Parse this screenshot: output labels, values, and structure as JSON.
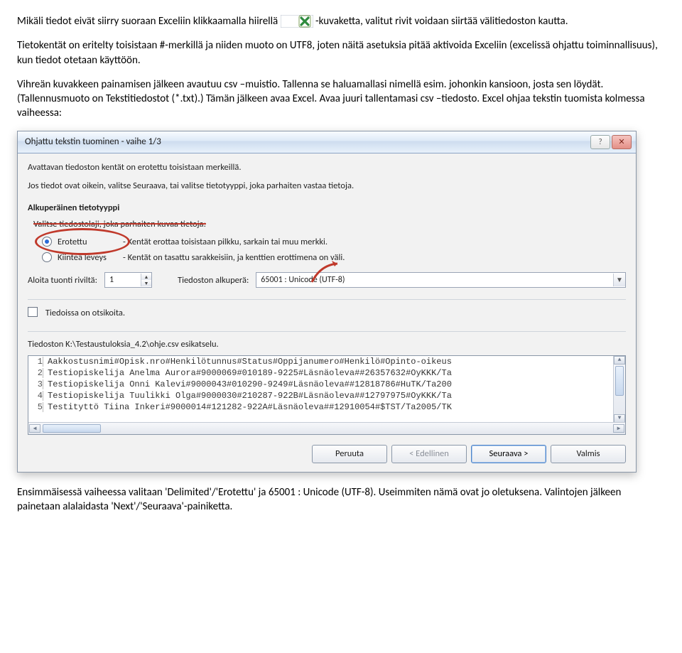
{
  "doc": {
    "p1a": "Mikäli tiedot eivät siirry suoraan Exceliin klikkaamalla hiirellä ",
    "p1b": "-kuvaketta, valitut rivit voidaan siirtää välitiedoston kautta.",
    "p2": "Tietokentät on eritelty toisistaan #-merkillä ja niiden muoto on UTF8, joten näitä asetuksia pitää aktivoida Exceliin (excelissä ohjattu toiminnallisuus), kun tiedot otetaan käyttöön.",
    "p3": "Vihreän kuvakkeen painamisen jälkeen avautuu csv –muistio. Tallenna se haluamallasi nimellä esim. johonkin kansioon, josta sen löydät. (Tallennusmuoto on Tekstitiedostot (*.txt).) Tämän jälkeen avaa Excel. Avaa juuri tallentamasi csv –tiedosto. Excel ohjaa tekstin tuomista kolmessa vaiheessa:",
    "p4": "Ensimmäisessä vaiheessa valitaan 'Delimited'/'Erotettu' ja 65001 : Unicode (UTF-8). Useimmiten nämä ovat jo oletuksena. Valintojen jälkeen painetaan alalaidasta 'Next'/'Seuraava'-painiketta."
  },
  "dialog": {
    "title": "Ohjattu tekstin tuominen - vaihe 1/3",
    "intro": "Avattavan tiedoston kentät on erotettu toisistaan merkeillä.",
    "sub": "Jos tiedot ovat oikein, valitse Seuraava, tai valitse tietotyyppi, joka parhaiten vastaa tietoja.",
    "group_title": "Alkuperäinen tietotyyppi",
    "chooser_prompt": "Valitse tiedostolaji, joka parhaiten kuvaa tietoja:",
    "opt1_label": "Erotettu",
    "opt1_desc": "- Kentät erottaa toisistaan pilkku, sarkain tai muu merkki.",
    "opt2_label": "Kiinteä leveys",
    "opt2_desc": "- Kentät on tasattu sarakkeisiin, ja kenttien erottimena on väli.",
    "start_row_label": "Aloita tuonti riviltä:",
    "start_row_value": "1",
    "origin_label": "Tiedoston alkuperä:",
    "origin_value": "65001 : Unicode (UTF-8)",
    "headers_checkbox": "Tiedoissa on otsikoita.",
    "preview_label": "Tiedoston K:\\Testaustuloksia_4.2\\ohje.csv esikatselu.",
    "preview_lines": [
      "Aakkostusnimi#Opisk.nro#Henkilötunnus#Status#Oppijanumero#Henkilö#Opinto-oikeus",
      "Testiopiskelija Anelma Aurora#9000069#010189-9225#Läsnäoleva##26357632#OyKKK/Ta",
      "Testiopiskelija Onni Kalevi#9000043#010290-9249#Läsnäoleva##12818786#HuTK/Ta200",
      "Testiopiskelija Tuulikki Olga#9000030#210287-922B#Läsnäoleva##12797975#OyKKK/Ta",
      "Testityttö Tiina Inkeri#9000014#121282-922A#Läsnäoleva##12910054#$TST/Ta2005/TK"
    ],
    "buttons": {
      "cancel": "Peruuta",
      "back": "< Edellinen",
      "next": "Seuraava >",
      "finish": "Valmis"
    }
  }
}
